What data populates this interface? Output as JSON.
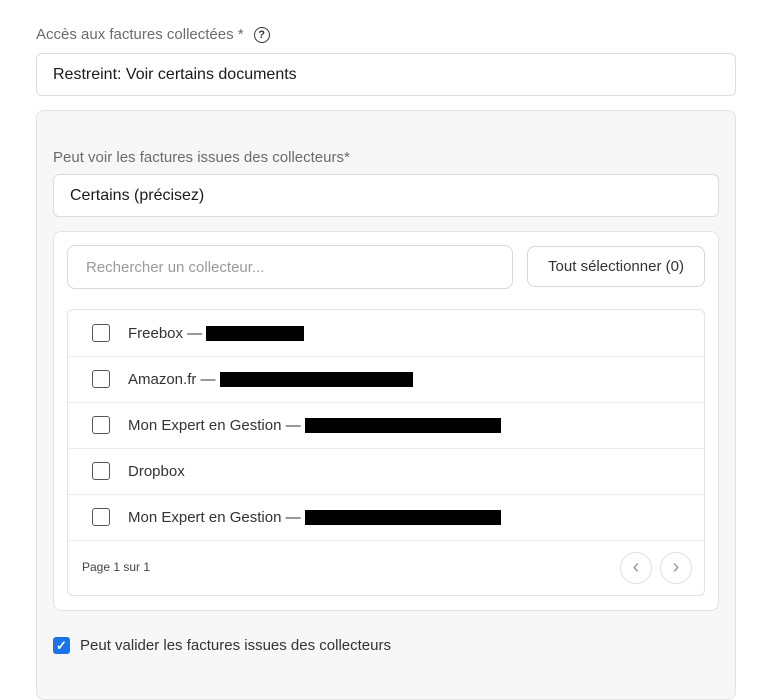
{
  "access": {
    "label": "Accès aux factures collectées *",
    "help_glyph": "?",
    "value": "Restreint: Voir certains documents"
  },
  "collectors_section": {
    "label": "Peut voir les factures issues des collecteurs",
    "required_mark": "*",
    "value": "Certains (précisez)"
  },
  "search": {
    "placeholder": "Rechercher un collecteur..."
  },
  "select_all_label": "Tout sélectionner (0)",
  "collectors": [
    {
      "name": "Freebox —",
      "checked": false
    },
    {
      "name": "Amazon.fr —",
      "checked": false
    },
    {
      "name": "Mon Expert en Gestion —",
      "checked": false
    },
    {
      "name": "Dropbox",
      "checked": false
    },
    {
      "name": "Mon Expert en Gestion —",
      "checked": false
    }
  ],
  "pagination": {
    "text": "Page 1 sur 1",
    "prev_glyph": "‹",
    "next_glyph": "›"
  },
  "validate": {
    "label": "Peut valider les factures issues des collecteurs",
    "checked": true,
    "check_glyph": "✓"
  },
  "colors": {
    "accent": "#1a73e8",
    "panel_bg": "#f7f7f7",
    "border": "#e3e3e3"
  }
}
